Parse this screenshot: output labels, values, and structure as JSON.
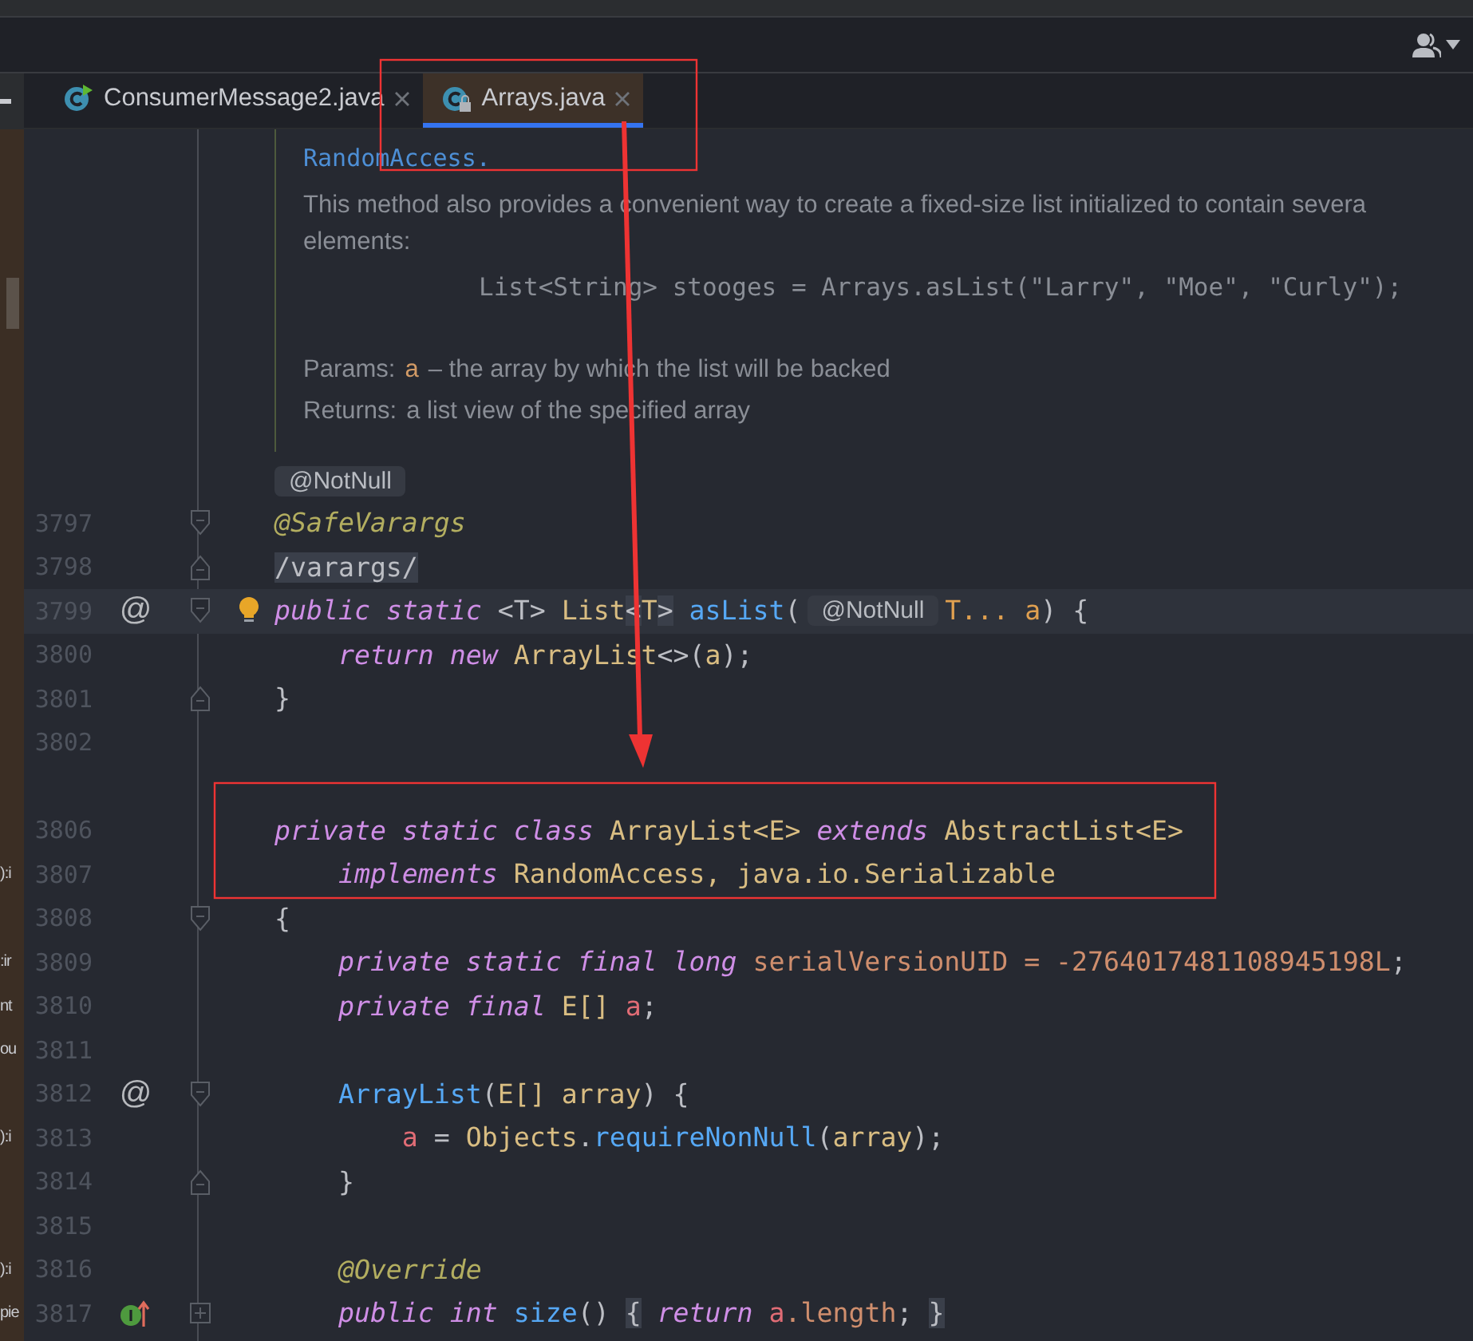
{
  "tabs": [
    {
      "label": "ConsumerMessage2.java",
      "selected": false,
      "kind": "runnable"
    },
    {
      "label": "Arrays.java",
      "selected": true,
      "kind": "locked"
    }
  ],
  "doc": {
    "link": "RandomAccess",
    "link_suffix": ".",
    "paragraph": [
      "This method also provides a convenient way to create a fixed-size list initialized to contain severa",
      "elements:"
    ],
    "example": "List<String> stooges = Arrays.asList(\"Larry\", \"Moe\", \"Curly\");",
    "params_label": "Params:",
    "param_name": "a",
    "param_text": "– the array by which the list will be backed",
    "returns_label": "Returns:",
    "returns_text": "a list view of the specified array"
  },
  "inlay_annotation": "@NotNull",
  "lines": [
    {
      "number": "3797",
      "current": false,
      "fold": {
        "kind": "start"
      },
      "bulb": false,
      "tokens": [
        {
          "kind": "ann",
          "text": "@SafeVarargs"
        }
      ]
    },
    {
      "number": "3798",
      "current": false,
      "fold": {
        "kind": "end"
      },
      "bulb": false,
      "tokens": [
        {
          "kind": "plain",
          "text": "/varargs/",
          "boxed": true
        }
      ]
    },
    {
      "number": "3799",
      "current": true,
      "gutter": {
        "kind": "glyph",
        "text": "@"
      },
      "fold": {
        "kind": "start"
      },
      "bulb": true,
      "tokens": [
        {
          "kind": "kw",
          "text": "public "
        },
        {
          "kind": "kw",
          "text": "static "
        },
        {
          "kind": "plain",
          "text": "<T> "
        },
        {
          "kind": "type",
          "text": "List"
        },
        {
          "kind": "plain",
          "text": "<",
          "boxed": true
        },
        {
          "kind": "type",
          "text": "T"
        },
        {
          "kind": "plain",
          "text": ">",
          "boxed": true
        },
        {
          "kind": "fn",
          "text": " asList"
        },
        {
          "kind": "plain",
          "text": "("
        },
        {
          "kind": "inlay",
          "text": "@NotNull"
        },
        {
          "kind": "param",
          "text": "T... a"
        },
        {
          "kind": "plain",
          "text": ") {"
        }
      ]
    },
    {
      "number": "3800",
      "current": false,
      "bulb": false,
      "tokens": [
        {
          "kind": "kw",
          "text": "    return "
        },
        {
          "kind": "kw",
          "text": "new "
        },
        {
          "kind": "type",
          "text": "ArrayList"
        },
        {
          "kind": "plain",
          "text": "<>("
        },
        {
          "kind": "type",
          "text": "a"
        },
        {
          "kind": "plain",
          "text": ");"
        }
      ]
    },
    {
      "number": "3801",
      "current": false,
      "fold": {
        "kind": "end"
      },
      "bulb": false,
      "tokens": [
        {
          "kind": "plain",
          "text": "}"
        }
      ]
    },
    {
      "number": "3802",
      "current": false,
      "bulb": false
    },
    {
      "current": false,
      "bulb": false
    },
    {
      "number": "3806",
      "current": false,
      "bulb": false,
      "tokens": [
        {
          "kind": "kw",
          "text": "private "
        },
        {
          "kind": "kw",
          "text": "static "
        },
        {
          "kind": "kw",
          "text": "class "
        },
        {
          "kind": "type",
          "text": "ArrayList<E> "
        },
        {
          "kind": "kw",
          "text": "extends "
        },
        {
          "kind": "type",
          "text": "AbstractList<E>"
        }
      ]
    },
    {
      "number": "3807",
      "current": false,
      "bulb": false,
      "side": "):i",
      "tokens": [
        {
          "kind": "kw",
          "text": "    implements "
        },
        {
          "kind": "type",
          "text": "RandomAccess, java.io.Serializable"
        }
      ]
    },
    {
      "number": "3808",
      "current": false,
      "fold": {
        "kind": "start"
      },
      "bulb": false,
      "tokens": [
        {
          "kind": "plain",
          "text": "{"
        }
      ]
    },
    {
      "number": "3809",
      "current": false,
      "bulb": false,
      "side": ":ir",
      "tokens": [
        {
          "kind": "kw",
          "text": "    private "
        },
        {
          "kind": "kw",
          "text": "static "
        },
        {
          "kind": "kw",
          "text": "final "
        },
        {
          "kind": "kw",
          "text": "long "
        },
        {
          "kind": "num",
          "text": "serialVersionUID = -2764017481108945198L"
        },
        {
          "kind": "plain",
          "text": ";"
        }
      ]
    },
    {
      "number": "3810",
      "current": false,
      "bulb": false,
      "side": "nt",
      "tokens": [
        {
          "kind": "kw",
          "text": "    private "
        },
        {
          "kind": "kw",
          "text": "final "
        },
        {
          "kind": "type",
          "text": "E[] "
        },
        {
          "kind": "field",
          "text": "a"
        },
        {
          "kind": "plain",
          "text": ";"
        }
      ]
    },
    {
      "number": "3811",
      "current": false,
      "bulb": false,
      "side": "ou"
    },
    {
      "number": "3812",
      "current": false,
      "gutter": {
        "kind": "glyph",
        "text": "@"
      },
      "fold": {
        "kind": "start"
      },
      "bulb": false,
      "tokens": [
        {
          "kind": "fn",
          "text": "    ArrayList"
        },
        {
          "kind": "plain",
          "text": "("
        },
        {
          "kind": "type",
          "text": "E[] array"
        },
        {
          "kind": "plain",
          "text": ") {"
        }
      ]
    },
    {
      "number": "3813",
      "current": false,
      "bulb": false,
      "side": "):i",
      "tokens": [
        {
          "kind": "field",
          "text": "        a"
        },
        {
          "kind": "plain",
          "text": " = "
        },
        {
          "kind": "type",
          "text": "Objects"
        },
        {
          "kind": "plain",
          "text": "."
        },
        {
          "kind": "fn",
          "text": "requireNonNull"
        },
        {
          "kind": "plain",
          "text": "("
        },
        {
          "kind": "type",
          "text": "array"
        },
        {
          "kind": "plain",
          "text": ");"
        }
      ]
    },
    {
      "number": "3814",
      "current": false,
      "fold": {
        "kind": "end"
      },
      "bulb": false,
      "tokens": [
        {
          "kind": "plain",
          "text": "    }"
        }
      ]
    },
    {
      "number": "3815",
      "current": false,
      "bulb": false
    },
    {
      "number": "3816",
      "current": false,
      "bulb": false,
      "side": "):i",
      "tokens": [
        {
          "kind": "ann",
          "text": "    @Override"
        }
      ]
    },
    {
      "number": "3817",
      "current": false,
      "gutter": {
        "kind": "implements"
      },
      "fold": {
        "kind": "collapsed"
      },
      "bulb": false,
      "side": "pie",
      "tokens": [
        {
          "kind": "kw",
          "text": "    public "
        },
        {
          "kind": "kw",
          "text": "int "
        },
        {
          "kind": "fn",
          "text": "size"
        },
        {
          "kind": "plain",
          "text": "() "
        },
        {
          "kind": "plain",
          "text": "{",
          "boxed": true
        },
        {
          "kind": "kw",
          "text": " return "
        },
        {
          "kind": "field",
          "text": "a"
        },
        {
          "kind": "num",
          "text": ".length"
        },
        {
          "kind": "plain",
          "text": "; "
        },
        {
          "kind": "plain",
          "text": "}",
          "boxed": true
        }
      ]
    }
  ]
}
